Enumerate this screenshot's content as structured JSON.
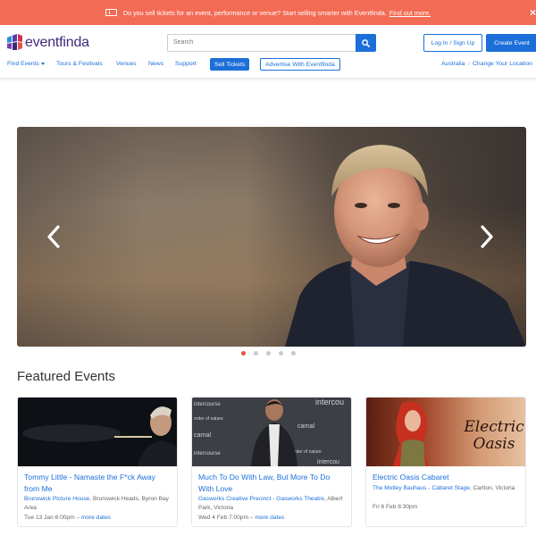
{
  "promo": {
    "text": "Do you sell tickets for an event, performance or venue? Start selling smarter with Eventfinda.",
    "link": "Find out more.",
    "close": "×"
  },
  "header": {
    "logo_text": "eventfinda",
    "search_placeholder": "Search",
    "login_label": "Log In / Sign Up",
    "create_label": "Create Event"
  },
  "nav": {
    "find_events": "Find Events",
    "tours": "Tours & Festivals",
    "venues": "Venues",
    "news": "News",
    "support": "Support",
    "sell_tickets": "Sell Tickets",
    "advertise": "Advertise With Eventfinda",
    "location": "Australia",
    "separator": "/",
    "change_location": "Change Your Location"
  },
  "hero": {
    "slide_count": 5,
    "active_slide": 1
  },
  "featured": {
    "title": "Featured Events",
    "cards": [
      {
        "title": "Tommy Little - Namaste the F*ck Away from Me",
        "venue_link": "Brunswick Picture House",
        "venue_rest": ", Brunswick Heads, Byron Bay Area",
        "date": "Tue 13 Jan 6:00pm",
        "dash": " – ",
        "more": "more dates"
      },
      {
        "title": "Much To Do With Law, But More To Do With Love",
        "venue_link": "Gasworks Creative Precinct - Gasworks Theatre",
        "venue_rest": ", Albert Park, Victoria",
        "date": "Wed 4 Feb 7:00pm",
        "dash": " – ",
        "more": "more dates"
      },
      {
        "title": "Electric Oasis Cabaret",
        "venue_link": "The Motley Bauhaus - Cabaret Stage",
        "venue_rest": ", Carlton, Victoria",
        "date": "Fri 6 Feb 8:30pm",
        "dash": "",
        "more": ""
      }
    ],
    "poster_words": [
      "intercourse",
      "order of nature",
      "carnal",
      "carnal",
      "intercourse",
      "order of nature",
      "intercou",
      "carnal",
      "intercou"
    ],
    "electric_top": "Electric",
    "electric_bottom": "Oasis"
  },
  "colors": {
    "brand_blue": "#1c6fd8",
    "promo_bg": "#f26b54",
    "logo_purple": "#3e2a7a",
    "dot_active": "#e9503d"
  },
  "icons": [
    "ticket-icon",
    "close-icon",
    "logo-mark-icon",
    "search-icon",
    "caret-down-icon",
    "chevron-left-icon",
    "chevron-right-icon"
  ]
}
